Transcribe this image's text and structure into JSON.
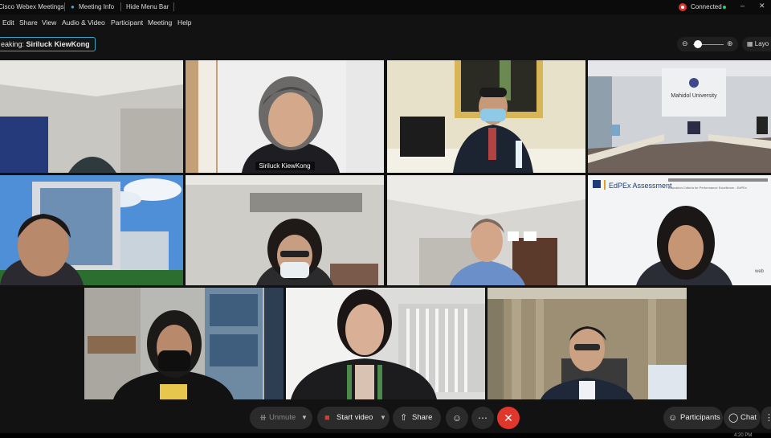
{
  "titlebar": {
    "app_title": "Cisco Webex Meetings",
    "meeting_info": "Meeting Info",
    "hide_menu": "Hide Menu Bar",
    "status": "Connected",
    "minimize": "–",
    "close": "✕"
  },
  "menu": [
    "Edit",
    "Share",
    "View",
    "Audio & Video",
    "Participant",
    "Meeting",
    "Help"
  ],
  "speaking": {
    "prefix": "eaking:",
    "name": "Siriluck KiewKong"
  },
  "layout_label": "Layo",
  "participants": [
    {
      "name": ""
    },
    {
      "name": "Siriluck KiewKong"
    },
    {
      "name": ""
    },
    {
      "name": ""
    },
    {
      "name": ""
    },
    {
      "name": ""
    },
    {
      "name": ""
    },
    {
      "name": ""
    },
    {
      "name": ""
    },
    {
      "name": ""
    },
    {
      "name": ""
    }
  ],
  "tile_text": {
    "university_sign": "Mahidol University",
    "edpex_title": "EdPEx Assessment",
    "edpex_sub": "Education Criteria for Performance Excellence - EdPEx",
    "webex_mark": "web"
  },
  "controls": {
    "unmute": "Unmute",
    "start_video": "Start video",
    "share": "Share",
    "participants": "Participants",
    "chat": "Chat"
  },
  "clock": "4:20 PM",
  "colors": {
    "accent": "#3aa6c9",
    "end_call": "#e0362b",
    "connected": "#d9342b"
  }
}
